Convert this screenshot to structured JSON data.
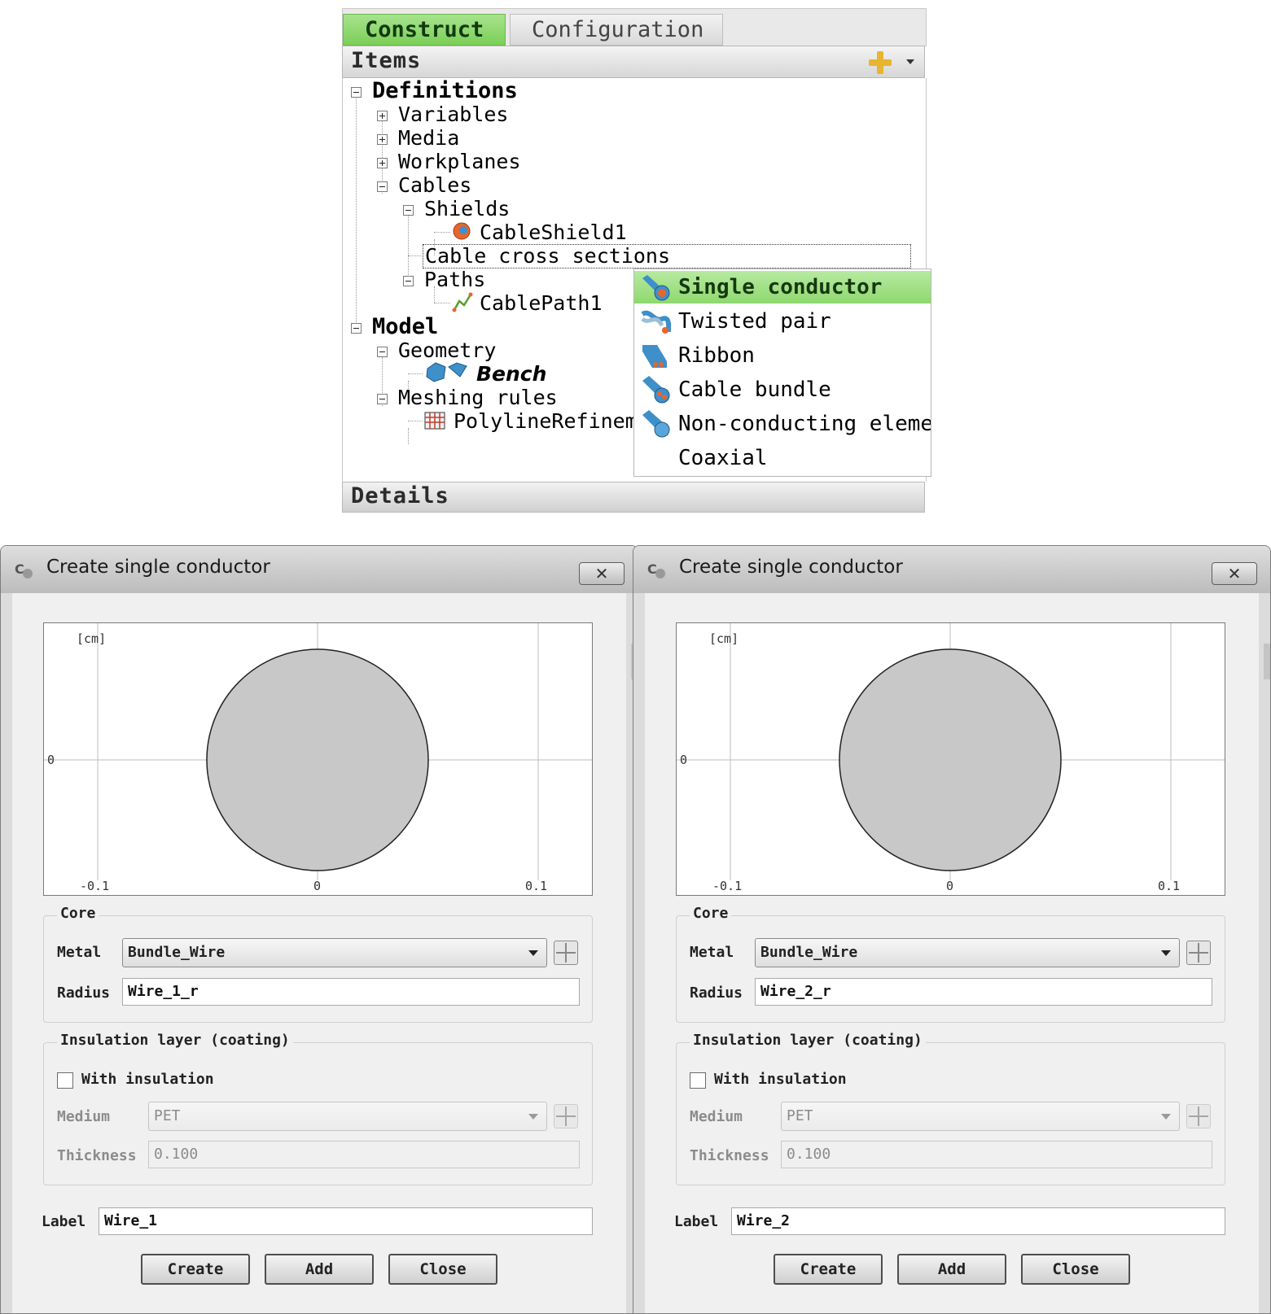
{
  "tabs": [
    {
      "label": "Construct",
      "active": true
    },
    {
      "label": "Configuration",
      "active": false
    }
  ],
  "items_header": "Items",
  "details_header": "Details",
  "tree": {
    "definitions": "Definitions",
    "variables": "Variables",
    "media": "Media",
    "workplanes": "Workplanes",
    "cables": "Cables",
    "shields": "Shields",
    "cable_shield": "CableShield1",
    "cable_cross_sections": "Cable cross sections",
    "paths": "Paths",
    "cable_path": "CablePath1",
    "model": "Model",
    "geometry": "Geometry",
    "bench": "Bench",
    "meshing_rules": "Meshing rules",
    "polyline_refinement": "PolylineRefinem"
  },
  "context_menu": {
    "items": [
      "Single conductor",
      "Twisted pair",
      "Ribbon",
      "Cable bundle",
      "Non-conducting elemer",
      "Coaxial"
    ],
    "highlighted": "Single conductor"
  },
  "colors": {
    "accent_green": "#8fd86f",
    "circle_fill": "#c8c8c8",
    "icon_blue": "#3f8fc9",
    "icon_orange": "#e9652d"
  },
  "dialogs": [
    {
      "title": "Create single conductor",
      "close_label": "✕",
      "plot": {
        "unit": "[cm]",
        "x_ticks": [
          "-0.1",
          "0",
          "0.1"
        ],
        "y_tick": "0"
      },
      "core": {
        "legend": "Core",
        "metal_label": "Metal",
        "metal_value": "Bundle_Wire",
        "radius_label": "Radius",
        "radius_value": "Wire_1_r"
      },
      "insulation": {
        "legend": "Insulation layer (coating)",
        "with_insulation_label": "With insulation",
        "with_insulation_checked": false,
        "medium_label": "Medium",
        "medium_value": "PET",
        "thickness_label": "Thickness",
        "thickness_value": "0.100"
      },
      "label_label": "Label",
      "label_value": "Wire_1",
      "buttons": {
        "create": "Create",
        "add": "Add",
        "close": "Close"
      }
    },
    {
      "title": "Create single conductor",
      "close_label": "✕",
      "plot": {
        "unit": "[cm]",
        "x_ticks": [
          "-0.1",
          "0",
          "0.1"
        ],
        "y_tick": "0"
      },
      "core": {
        "legend": "Core",
        "metal_label": "Metal",
        "metal_value": "Bundle_Wire",
        "radius_label": "Radius",
        "radius_value": "Wire_2_r"
      },
      "insulation": {
        "legend": "Insulation layer (coating)",
        "with_insulation_label": "With insulation",
        "with_insulation_checked": false,
        "medium_label": "Medium",
        "medium_value": "PET",
        "thickness_label": "Thickness",
        "thickness_value": "0.100"
      },
      "label_label": "Label",
      "label_value": "Wire_2",
      "buttons": {
        "create": "Create",
        "add": "Add",
        "close": "Close"
      }
    }
  ]
}
